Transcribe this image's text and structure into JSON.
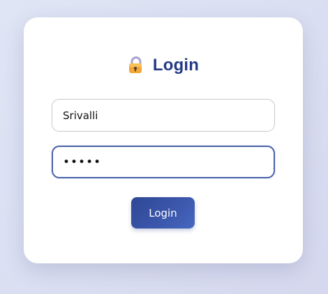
{
  "login": {
    "title": "Login",
    "title_icon": "lock-icon",
    "username_value": "Srivalli",
    "password_masked": "•••••",
    "button_label": "Login"
  },
  "colors": {
    "accent": "#2f4794",
    "title": "#243a86",
    "focus_border": "#4a63aa"
  }
}
